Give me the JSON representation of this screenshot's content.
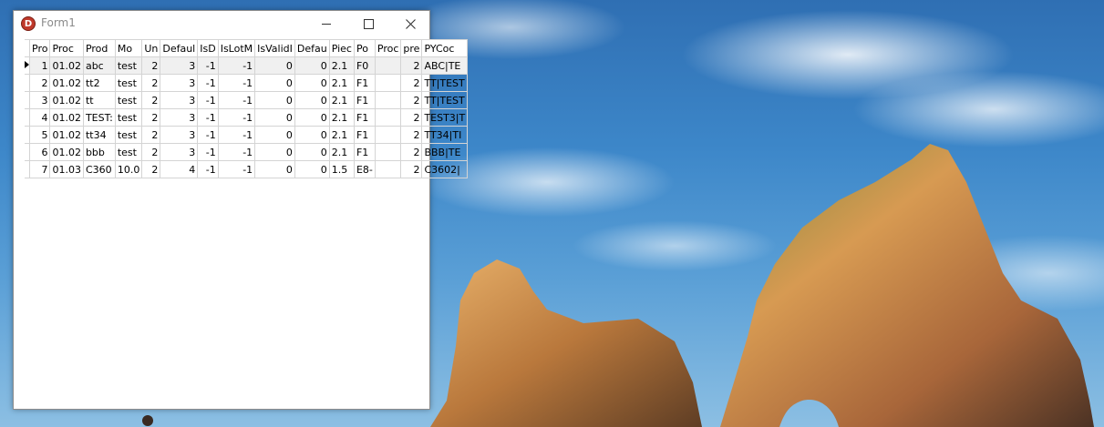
{
  "window": {
    "title": "Form1",
    "app_icon_letter": "D"
  },
  "grid": {
    "columns": [
      "Pro",
      "Proc",
      "Prod",
      "Mo",
      "Un",
      "Defaul",
      "IsD",
      "IsLotM",
      "IsValidI",
      "Defau",
      "Piec",
      "Po",
      "Proc",
      "pre",
      "PYCoc"
    ],
    "rows": [
      [
        "1",
        "01.02",
        "abc",
        "test",
        "2",
        "3",
        "-1",
        "-1",
        "0",
        "0",
        "2.1",
        "F0",
        "",
        "2",
        "ABC|TE"
      ],
      [
        "2",
        "01.02",
        "tt2",
        "test",
        "2",
        "3",
        "-1",
        "-1",
        "0",
        "0",
        "2.1",
        "F1",
        "",
        "2",
        "TT|TEST"
      ],
      [
        "3",
        "01.02",
        "tt",
        "test",
        "2",
        "3",
        "-1",
        "-1",
        "0",
        "0",
        "2.1",
        "F1",
        "",
        "2",
        "TT|TEST"
      ],
      [
        "4",
        "01.02",
        "TEST:",
        "test",
        "2",
        "3",
        "-1",
        "-1",
        "0",
        "0",
        "2.1",
        "F1",
        "",
        "2",
        "TEST3|T"
      ],
      [
        "5",
        "01.02",
        "tt34",
        "test",
        "2",
        "3",
        "-1",
        "-1",
        "0",
        "0",
        "2.1",
        "F1",
        "",
        "2",
        "TT34|TI"
      ],
      [
        "6",
        "01.02",
        "bbb",
        "test",
        "2",
        "3",
        "-1",
        "-1",
        "0",
        "0",
        "2.1",
        "F1",
        "",
        "2",
        "BBB|TE"
      ],
      [
        "7",
        "01.03",
        "C360",
        "10.0",
        "2",
        "4",
        "-1",
        "-1",
        "0",
        "0",
        "1.5",
        "E8-",
        "",
        "2",
        "C3602|"
      ]
    ],
    "current_row": 0,
    "numeric_columns": [
      0,
      4,
      5,
      6,
      7,
      8,
      9,
      13
    ]
  },
  "colors": {
    "window_bg": "#ffffff",
    "grid_line": "#d4d4d4",
    "title_text": "#8a8a8a"
  }
}
